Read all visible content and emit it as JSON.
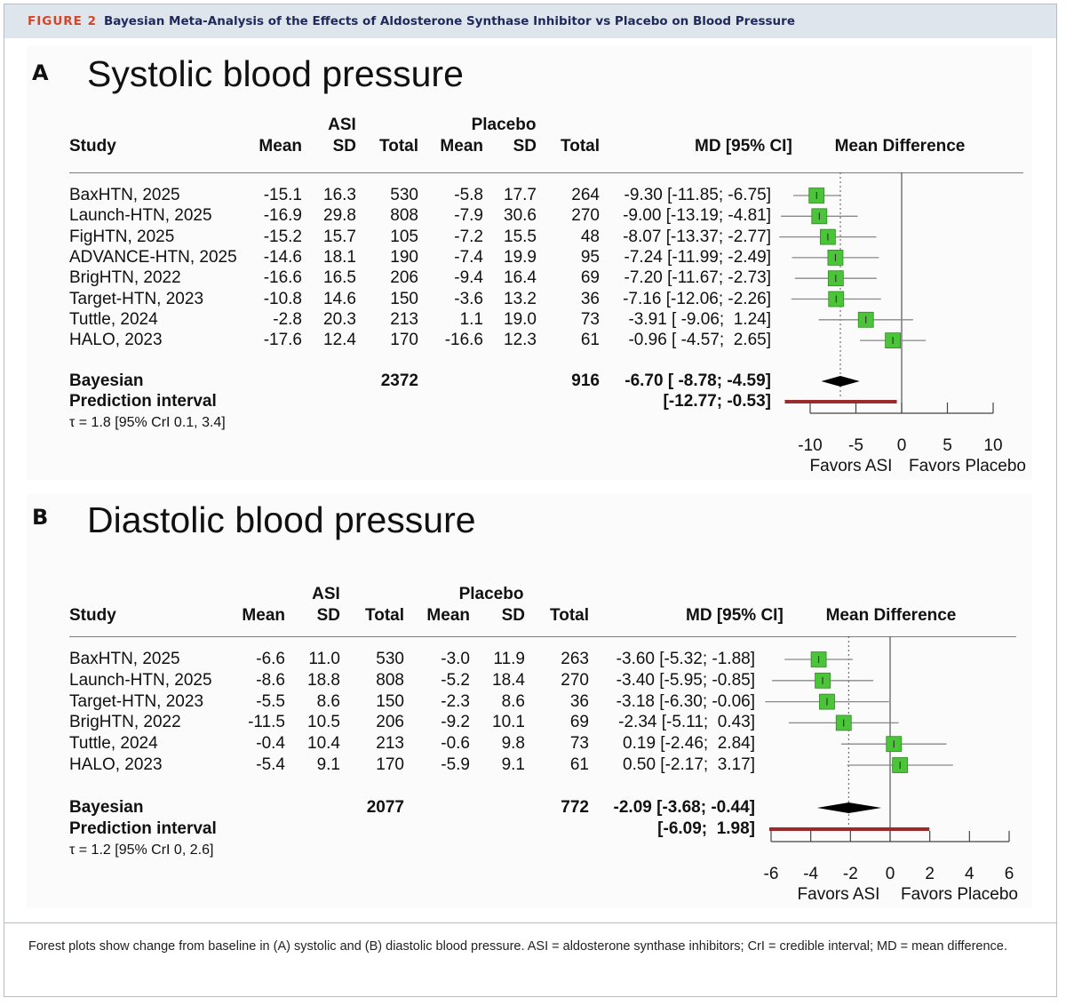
{
  "figure": {
    "label": "FIGURE 2",
    "title": "Bayesian Meta-Analysis of the Effects of Aldosterone Synthase Inhibitor vs Placebo on Blood Pressure"
  },
  "headers": {
    "study": "Study",
    "asi_group": "ASI",
    "placebo_group": "Placebo",
    "mean": "Mean",
    "sd": "SD",
    "total": "Total",
    "md_ci": "MD [95% CI]",
    "mean_difference": "Mean Difference"
  },
  "panels": [
    {
      "letter": "A",
      "title": "Systolic blood pressure",
      "rows": [
        {
          "study": "BaxHTN, 2025",
          "asi_mean": "-15.1",
          "asi_sd": "16.3",
          "asi_total": "530",
          "pl_mean": "-5.8",
          "pl_sd": "17.7",
          "pl_total": "264",
          "ci_text": "-9.30 [-11.85; -6.75]"
        },
        {
          "study": "Launch-HTN, 2025",
          "asi_mean": "-16.9",
          "asi_sd": "29.8",
          "asi_total": "808",
          "pl_mean": "-7.9",
          "pl_sd": "30.6",
          "pl_total": "270",
          "ci_text": "-9.00 [-13.19; -4.81]"
        },
        {
          "study": "FigHTN, 2025",
          "asi_mean": "-15.2",
          "asi_sd": "15.7",
          "asi_total": "105",
          "pl_mean": "-7.2",
          "pl_sd": "15.5",
          "pl_total": "48",
          "ci_text": "-8.07 [-13.37; -2.77]"
        },
        {
          "study": "ADVANCE-HTN, 2025",
          "asi_mean": "-14.6",
          "asi_sd": "18.1",
          "asi_total": "190",
          "pl_mean": "-7.4",
          "pl_sd": "19.9",
          "pl_total": "95",
          "ci_text": "-7.24 [-11.99; -2.49]"
        },
        {
          "study": "BrigHTN, 2022",
          "asi_mean": "-16.6",
          "asi_sd": "16.5",
          "asi_total": "206",
          "pl_mean": "-9.4",
          "pl_sd": "16.4",
          "pl_total": "69",
          "ci_text": "-7.20 [-11.67; -2.73]"
        },
        {
          "study": "Target-HTN, 2023",
          "asi_mean": "-10.8",
          "asi_sd": "14.6",
          "asi_total": "150",
          "pl_mean": "-3.6",
          "pl_sd": "13.2",
          "pl_total": "36",
          "ci_text": "-7.16 [-12.06; -2.26]"
        },
        {
          "study": "Tuttle, 2024",
          "asi_mean": "-2.8",
          "asi_sd": "20.3",
          "asi_total": "213",
          "pl_mean": "1.1",
          "pl_sd": "19.0",
          "pl_total": "73",
          "ci_text": "-3.91 [ -9.06;  1.24]"
        },
        {
          "study": "HALO, 2023",
          "asi_mean": "-17.6",
          "asi_sd": "12.4",
          "asi_total": "170",
          "pl_mean": "-16.6",
          "pl_sd": "12.3",
          "pl_total": "61",
          "ci_text": "-0.96 [ -4.57;  2.65]"
        }
      ],
      "pooled": {
        "label": "Bayesian",
        "asi_total": "2372",
        "pl_total": "916",
        "ci_text": "-6.70 [ -8.78; -4.59]"
      },
      "prediction": {
        "label": "Prediction interval",
        "ci_text": "[-12.77; -0.53]"
      },
      "tau": "τ = 1.8 [95% CrI 0.1, 3.4]",
      "favors_left": "Favors ASI",
      "favors_right": "Favors Placebo"
    },
    {
      "letter": "B",
      "title": "Diastolic blood pressure",
      "rows": [
        {
          "study": "BaxHTN, 2025",
          "asi_mean": "-6.6",
          "asi_sd": "11.0",
          "asi_total": "530",
          "pl_mean": "-3.0",
          "pl_sd": "11.9",
          "pl_total": "263",
          "ci_text": "-3.60 [-5.32; -1.88]"
        },
        {
          "study": "Launch-HTN, 2025",
          "asi_mean": "-8.6",
          "asi_sd": "18.8",
          "asi_total": "808",
          "pl_mean": "-5.2",
          "pl_sd": "18.4",
          "pl_total": "270",
          "ci_text": "-3.40 [-5.95; -0.85]"
        },
        {
          "study": "Target-HTN, 2023",
          "asi_mean": "-5.5",
          "asi_sd": "8.6",
          "asi_total": "150",
          "pl_mean": "-2.3",
          "pl_sd": "8.6",
          "pl_total": "36",
          "ci_text": "-3.18 [-6.30; -0.06]"
        },
        {
          "study": "BrigHTN, 2022",
          "asi_mean": "-11.5",
          "asi_sd": "10.5",
          "asi_total": "206",
          "pl_mean": "-9.2",
          "pl_sd": "10.1",
          "pl_total": "69",
          "ci_text": "-2.34 [-5.11;  0.43]"
        },
        {
          "study": "Tuttle, 2024",
          "asi_mean": "-0.4",
          "asi_sd": "10.4",
          "asi_total": "213",
          "pl_mean": "-0.6",
          "pl_sd": "9.8",
          "pl_total": "73",
          "ci_text": "0.19 [-2.46;  2.84]"
        },
        {
          "study": "HALO, 2023",
          "asi_mean": "-5.4",
          "asi_sd": "9.1",
          "asi_total": "170",
          "pl_mean": "-5.9",
          "pl_sd": "9.1",
          "pl_total": "61",
          "ci_text": "0.50 [-2.17;  3.17]"
        }
      ],
      "pooled": {
        "label": "Bayesian",
        "asi_total": "2077",
        "pl_total": "772",
        "ci_text": "-2.09 [-3.68; -0.44]"
      },
      "prediction": {
        "label": "Prediction interval",
        "ci_text": "[-6.09;  1.98]"
      },
      "tau": "τ = 1.2 [95% CrI 0, 2.6]",
      "favors_left": "Favors ASI",
      "favors_right": "Favors Placebo"
    }
  ],
  "colors": {
    "square": "#4cc43a",
    "square_border": "#2f8a22",
    "prediction": "#9b2b2b",
    "diamond": "#000000"
  },
  "chart_data": [
    {
      "type": "forest",
      "title": "Systolic blood pressure",
      "xlabel": "Mean Difference",
      "xlim": [
        -10,
        10
      ],
      "ticks": [
        -10,
        -5,
        0,
        5,
        10
      ],
      "estimates": [
        {
          "study": "BaxHTN, 2025",
          "md": -9.3,
          "lo": -11.85,
          "hi": -6.75
        },
        {
          "study": "Launch-HTN, 2025",
          "md": -9.0,
          "lo": -13.19,
          "hi": -4.81
        },
        {
          "study": "FigHTN, 2025",
          "md": -8.07,
          "lo": -13.37,
          "hi": -2.77
        },
        {
          "study": "ADVANCE-HTN, 2025",
          "md": -7.24,
          "lo": -11.99,
          "hi": -2.49
        },
        {
          "study": "BrigHTN, 2022",
          "md": -7.2,
          "lo": -11.67,
          "hi": -2.73
        },
        {
          "study": "Target-HTN, 2023",
          "md": -7.16,
          "lo": -12.06,
          "hi": -2.26
        },
        {
          "study": "Tuttle, 2024",
          "md": -3.91,
          "lo": -9.06,
          "hi": 1.24
        },
        {
          "study": "HALO, 2023",
          "md": -0.96,
          "lo": -4.57,
          "hi": 2.65
        }
      ],
      "pooled": {
        "md": -6.7,
        "lo": -8.78,
        "hi": -4.59
      },
      "prediction_interval": [
        -12.77,
        -0.53
      ]
    },
    {
      "type": "forest",
      "title": "Diastolic blood pressure",
      "xlabel": "Mean Difference",
      "xlim": [
        -6,
        6
      ],
      "ticks": [
        -6,
        -4,
        -2,
        0,
        2,
        4,
        6
      ],
      "estimates": [
        {
          "study": "BaxHTN, 2025",
          "md": -3.6,
          "lo": -5.32,
          "hi": -1.88
        },
        {
          "study": "Launch-HTN, 2025",
          "md": -3.4,
          "lo": -5.95,
          "hi": -0.85
        },
        {
          "study": "Target-HTN, 2023",
          "md": -3.18,
          "lo": -6.3,
          "hi": -0.06
        },
        {
          "study": "BrigHTN, 2022",
          "md": -2.34,
          "lo": -5.11,
          "hi": 0.43
        },
        {
          "study": "Tuttle, 2024",
          "md": 0.19,
          "lo": -2.46,
          "hi": 2.84
        },
        {
          "study": "HALO, 2023",
          "md": 0.5,
          "lo": -2.17,
          "hi": 3.17
        }
      ],
      "pooled": {
        "md": -2.09,
        "lo": -3.68,
        "hi": -0.44
      },
      "prediction_interval": [
        -6.09,
        1.98
      ]
    }
  ],
  "caption": "Forest plots show change from baseline in (A) systolic and (B) diastolic blood pressure. ASI = aldosterone synthase inhibitors; CrI = credible interval; MD = mean difference."
}
